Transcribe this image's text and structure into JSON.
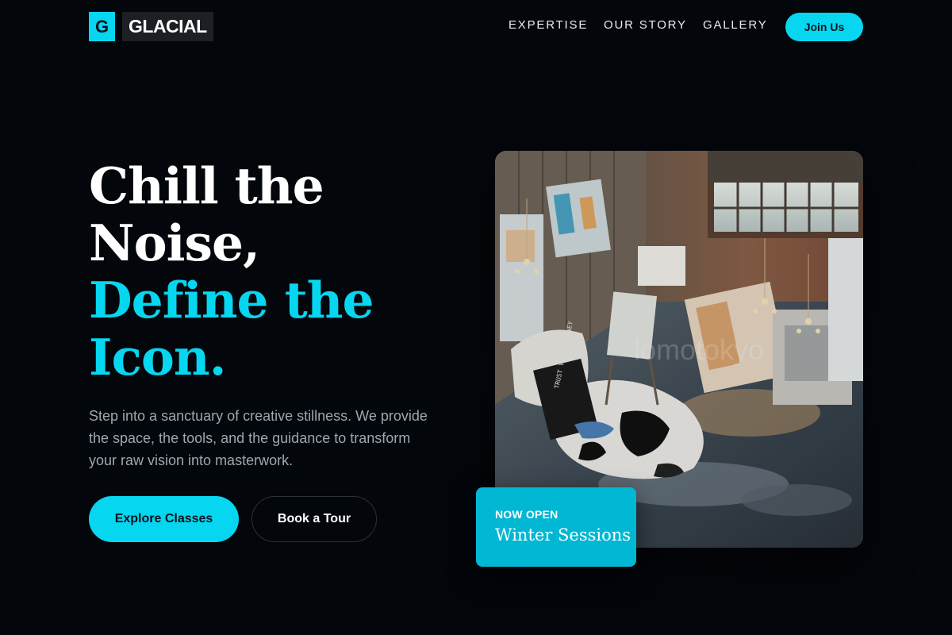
{
  "brand": {
    "mark": "G",
    "name": "GLACIAL"
  },
  "nav": {
    "links": [
      "EXPERTISE",
      "OUR STORY",
      "GALLERY"
    ],
    "cta": "Join Us"
  },
  "hero": {
    "headline_line1": "Chill the",
    "headline_line2": "Noise,",
    "headline_line3": "Define the",
    "headline_line4": "Icon.",
    "subtext": "Step into a sanctuary of creative stillness. We provide the space, the tools, and the guidance to transform your raw vision into masterwork.",
    "primary_cta": "Explore Classes",
    "secondary_cta": "Book a Tour"
  },
  "feature_card": {
    "image_subject": "art-studio-photo",
    "watermark": "lomotokyo",
    "sign_text": "TRUST YOUR JOURNEY",
    "badge_kicker": "NOW OPEN",
    "badge_title": "Winter Sessions"
  },
  "colors": {
    "background": "#03060b",
    "accent": "#06d6f0",
    "badge": "#00b7d4",
    "muted_text": "#9ea7b2"
  }
}
